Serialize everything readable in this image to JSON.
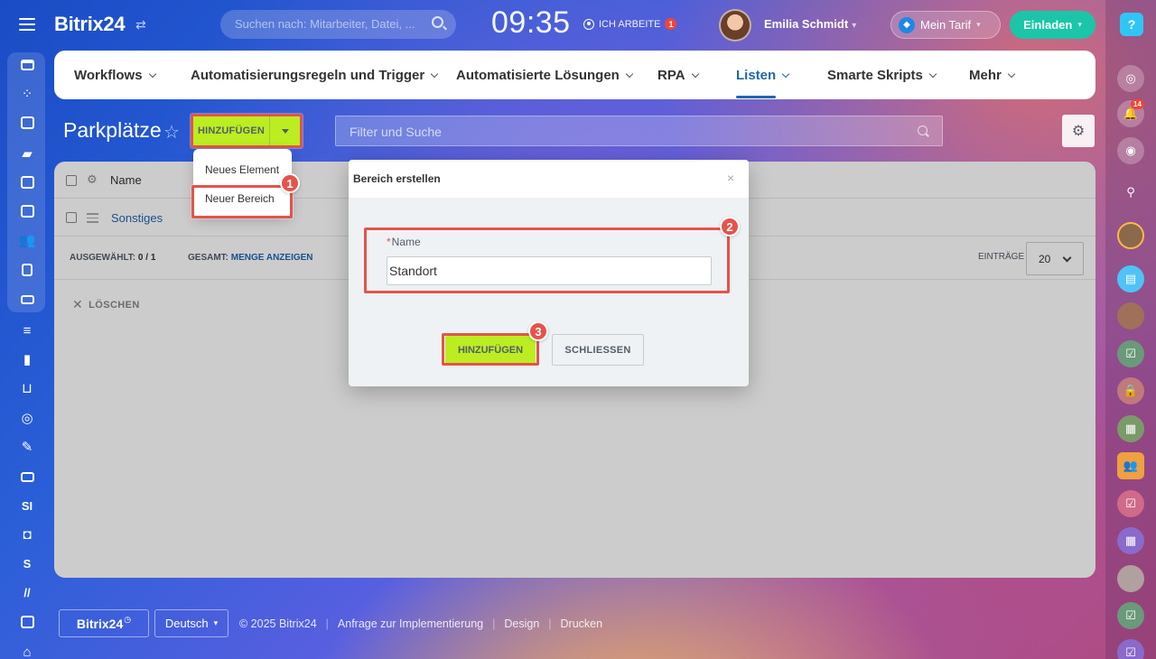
{
  "header": {
    "logo": "Bitrix24",
    "search_placeholder": "Suchen nach: Mitarbeiter, Datei, ...",
    "clock": "09:35",
    "work_status": "ICH ARBEITE",
    "work_badge": "1",
    "user_name": "Emilia Schmidt",
    "tarif_label": "Mein Tarif",
    "invite_label": "Einladen"
  },
  "nav": {
    "items": [
      {
        "label": "Workflows"
      },
      {
        "label": "Automatisierungsregeln und Trigger"
      },
      {
        "label": "Automatisierte Lösungen"
      },
      {
        "label": "RPA"
      },
      {
        "label": "Listen",
        "active": true
      },
      {
        "label": "Smarte Skripts"
      },
      {
        "label": "Mehr"
      }
    ]
  },
  "page": {
    "title": "Parkplätze",
    "add_button": "HINZUFÜGEN",
    "filter_placeholder": "Filter und Suche"
  },
  "dropdown": {
    "items": [
      "Neues Element",
      "Neuer Bereich"
    ]
  },
  "grid": {
    "column_name": "Name",
    "rows": [
      {
        "name": "Sonstiges"
      }
    ],
    "selected_label": "AUSGEWÄHLT:",
    "selected_value": "0 / 1",
    "total_label": "GESAMT:",
    "total_link": "MENGE ANZEIGEN",
    "entries_label": "EINTRÄGE",
    "entries_value": "20",
    "delete_label": "LÖSCHEN"
  },
  "modal": {
    "title": "Bereich erstellen",
    "field_label": "Name",
    "field_value": "Standort",
    "ok_label": "HINZUFÜGEN",
    "cancel_label": "SCHLIESSEN"
  },
  "steps": [
    "1",
    "2",
    "3"
  ],
  "left_sidebar": {
    "text_items": [
      "SI",
      "S"
    ]
  },
  "right_sidebar": {
    "notif_count": "14"
  },
  "footer": {
    "logo": "Bitrix24",
    "language": "Deutsch",
    "links": [
      "© 2025 Bitrix24",
      "Anfrage zur Implementierung",
      "Design",
      "Drucken"
    ]
  },
  "colors": {
    "accent_green": "#bbed21",
    "highlight_red": "#e5534b",
    "link_blue": "#2067b0",
    "invite_teal": "#1bc6a8"
  }
}
